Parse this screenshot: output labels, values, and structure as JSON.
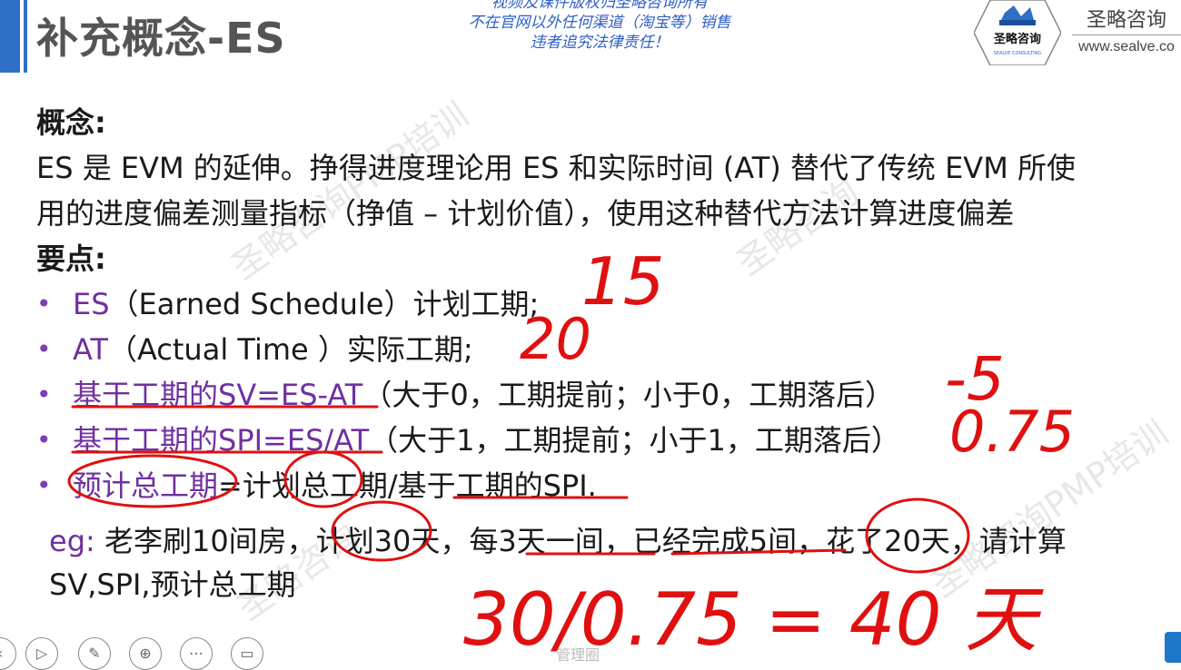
{
  "header": {
    "title": "补充概念-ES",
    "notice_lines": [
      "视频及课件版权归圣略咨询所有",
      "不在官网以外任何渠道（淘宝等）销售",
      "违者追究法律责任！"
    ],
    "logo_text": "圣略咨询",
    "logo_subtext": "SEALVE CONSULTING",
    "brand_name": "圣略咨询",
    "brand_url": "www.sealve.co"
  },
  "content": {
    "concept_heading": "概念:",
    "concept_line1": "ES 是 EVM 的延伸。挣得进度理论用 ES 和实际时间 (AT) 替代了传统 EVM 所使",
    "concept_line2": "用的进度偏差测量指标（挣值 – 计划价值），使用这种替代方法计算进度偏差",
    "points_heading": "要点:",
    "points": [
      {
        "key": "ES",
        "rest": "（Earned Schedule）计划工期;"
      },
      {
        "key": "AT",
        "rest": "（Actual Time ）实际工期;"
      },
      {
        "key": "基于工期的SV=ES-AT",
        "rest": "（大于0，工期提前；小于0，工期落后）"
      },
      {
        "key": "基于工期的SPI=ES/AT",
        "rest": "（大于1，工期提前；小于1，工期落后）"
      },
      {
        "key": "预计总工期",
        "rest": "=计划总工期/基于工期的SPI."
      }
    ],
    "eg_label": "eg:",
    "eg_line1": "老李刷10间房，计划30天，每3天一间，已经完成5间，花了20天，请计算",
    "eg_line2": "SV,SPI,预计总工期"
  },
  "handwriting": {
    "es_value": "15",
    "at_value": "20",
    "sv_value": "-5",
    "spi_value": "0.75",
    "result": "30/0.75 = 40 天"
  },
  "watermarks": [
    "圣略咨询PMP培训",
    "圣略咨询",
    "圣略咨询PMP培训",
    "圣略咨询"
  ],
  "footer": {
    "source": "管理圈"
  },
  "colors": {
    "accent_blue": "#2f6fc6",
    "point_purple": "#7030a0",
    "ink_red": "#e01010"
  }
}
